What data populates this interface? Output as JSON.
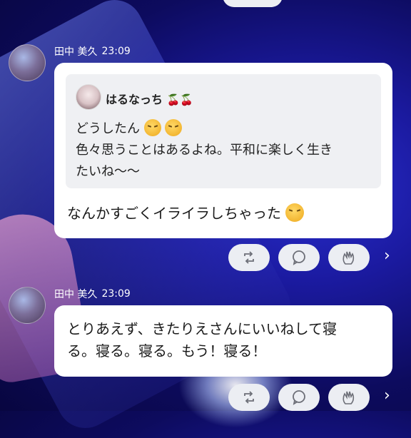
{
  "messages": [
    {
      "sender": "田中 美久",
      "time": "23:09",
      "quote": {
        "author": "はるなっち",
        "author_emojis": "🍒🍒",
        "line1": "どうしたん",
        "line2": "色々思うことはあるよね。平和に楽しく生き",
        "line3": "たいね〜〜"
      },
      "text": "なんかすごくイライラしちゃった"
    },
    {
      "sender": "田中 美久",
      "time": "23:09",
      "text_line1": "とりあえず、きたりえさんにいいねして寝",
      "text_line2": "る。寝る。寝る。もう！寝る！"
    }
  ],
  "actions": {
    "repost_icon": "repost-icon",
    "comment_icon": "comment-bubble-icon",
    "clap_icon": "clap-hands-icon",
    "more_icon": "chevron-right-icon"
  },
  "colors": {
    "background": "#1b1aa0",
    "bubble": "#ffffff",
    "quote": "#eff0f3",
    "action_button": "#eceef3"
  }
}
